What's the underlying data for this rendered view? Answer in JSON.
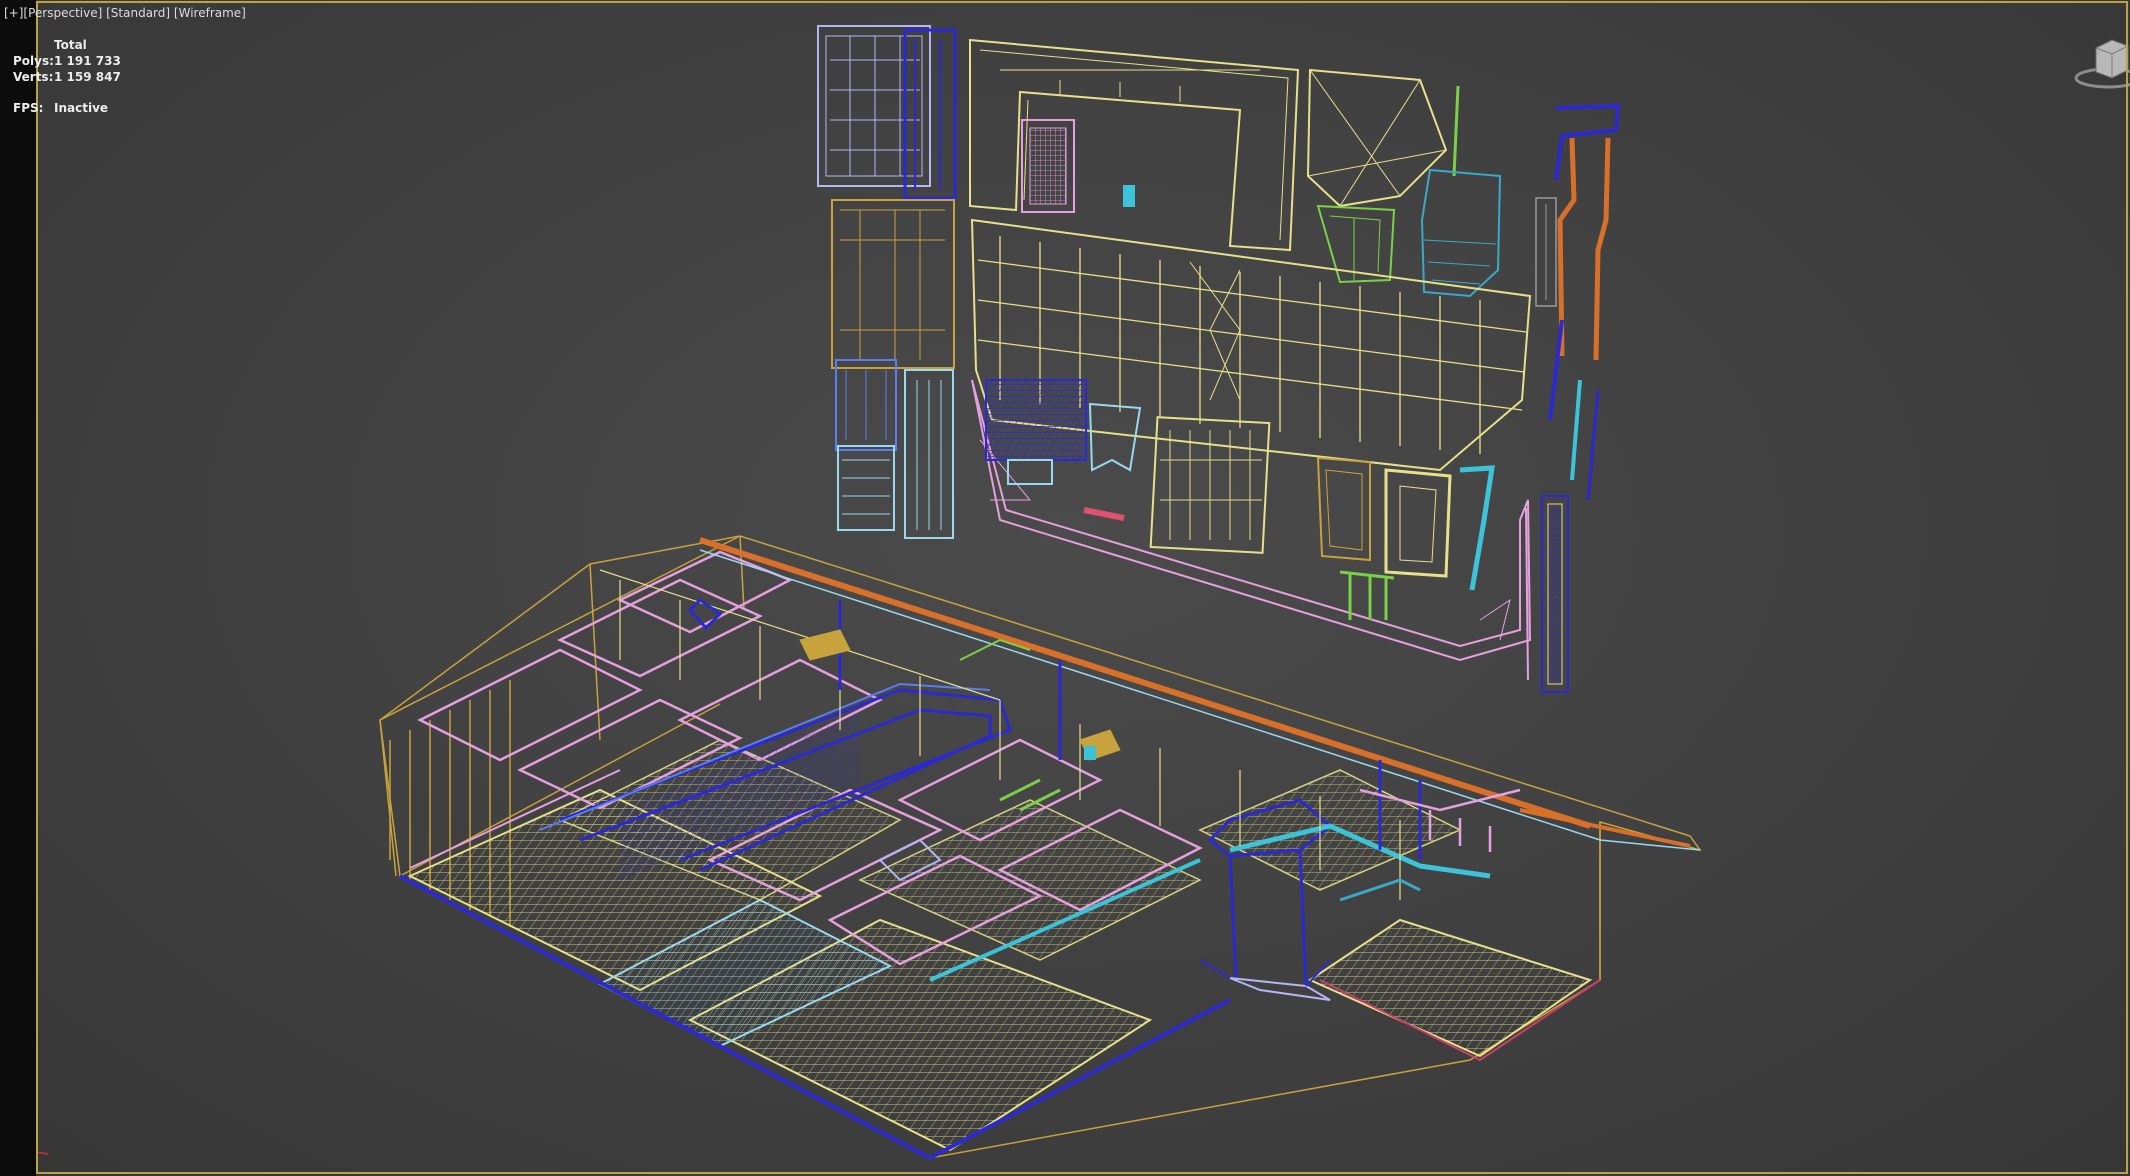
{
  "viewport": {
    "label_plus": "[+]",
    "label_view": "[Perspective]",
    "label_shading_style": "[Standard]",
    "label_render_mode": "[Wireframe]",
    "border_color": "#b9a24a"
  },
  "stats": {
    "header": "Total",
    "polys_label": "Polys:",
    "polys_value": "1 191 733",
    "verts_label": "Verts:",
    "verts_value": "1 159 847",
    "fps_label": "FPS:",
    "fps_value": "Inactive"
  },
  "icons": {
    "viewcube": "viewcube-icon",
    "axis": "axis-tripod-icon"
  },
  "wire_colors": {
    "yellow": "#e6e08a",
    "gold": "#c8a23c",
    "lavender": "#b7b4f2",
    "navy": "#2a2ad0",
    "blue": "#5a7ef0",
    "cyan": "#3cc3d8",
    "lightblue": "#9ad8f0",
    "pink": "#e6a0e0",
    "green": "#7ad048",
    "orange": "#d8702a",
    "teal": "#3aa8c8"
  }
}
